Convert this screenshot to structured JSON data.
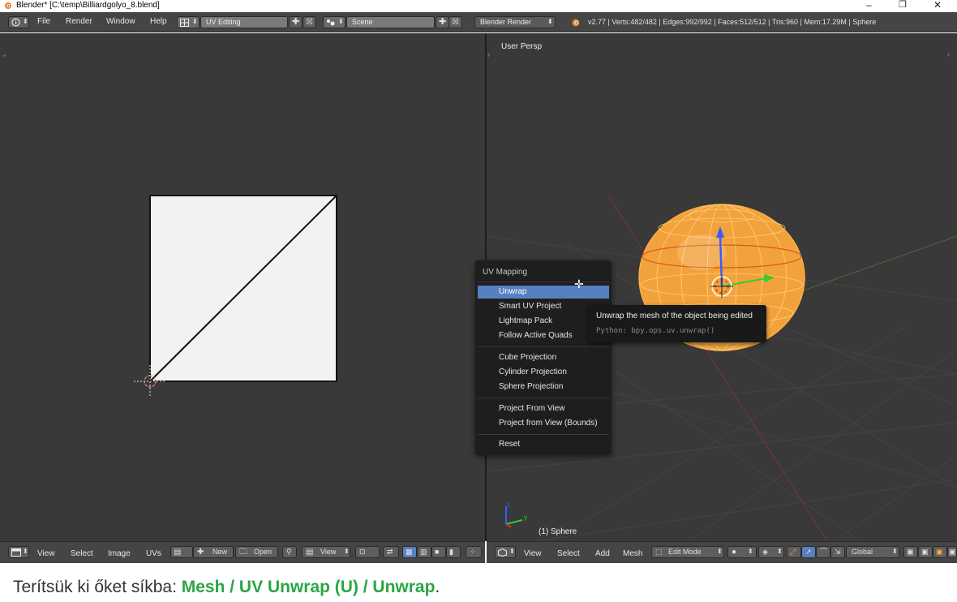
{
  "window": {
    "title": "Blender* [C:\\temp\\Billiardgolyo_8.blend]",
    "minimize_glyph": "–",
    "restore_glyph": "❐",
    "close_glyph": "✕"
  },
  "top_header": {
    "menus": [
      "File",
      "Render",
      "Window",
      "Help"
    ],
    "screen_layout": "UV Editing",
    "scene": "Scene",
    "render_engine": "Blender Render",
    "stats": "v2.77 | Verts:482/482 | Edges:992/992 | Faces:512/512 | Tris:960 | Mem:17.29M | Sphere"
  },
  "viewport": {
    "view_label": "User Persp",
    "object_label": "(1) Sphere"
  },
  "uv_menu": {
    "title": "UV Mapping",
    "items": [
      "Unwrap",
      "Smart UV Project",
      "Lightmap Pack",
      "Follow Active Quads",
      "Cube Projection",
      "Cylinder Projection",
      "Sphere Projection",
      "Project From View",
      "Project from View (Bounds)",
      "Reset"
    ],
    "active_index": 0
  },
  "tooltip": {
    "description": "Unwrap the mesh of the object being edited",
    "python": "Python: bpy.ops.uv.unwrap()"
  },
  "uv_header": {
    "menus": [
      "View",
      "Select",
      "Image",
      "UVs"
    ],
    "new_label": "New",
    "open_label": "Open",
    "view_label": "View"
  },
  "view3d_header": {
    "menus": [
      "View",
      "Select",
      "Add",
      "Mesh"
    ],
    "mode": "Edit Mode",
    "orientation": "Global"
  },
  "caption": {
    "prefix": "Terítsük ki őket síkba: ",
    "path": "Mesh / UV Unwrap (U) / Unwrap",
    "suffix": "."
  },
  "colors": {
    "sphere": "#f2a23c",
    "menu_highlight": "#5680c2",
    "caption_highlight": "#2aa644"
  }
}
